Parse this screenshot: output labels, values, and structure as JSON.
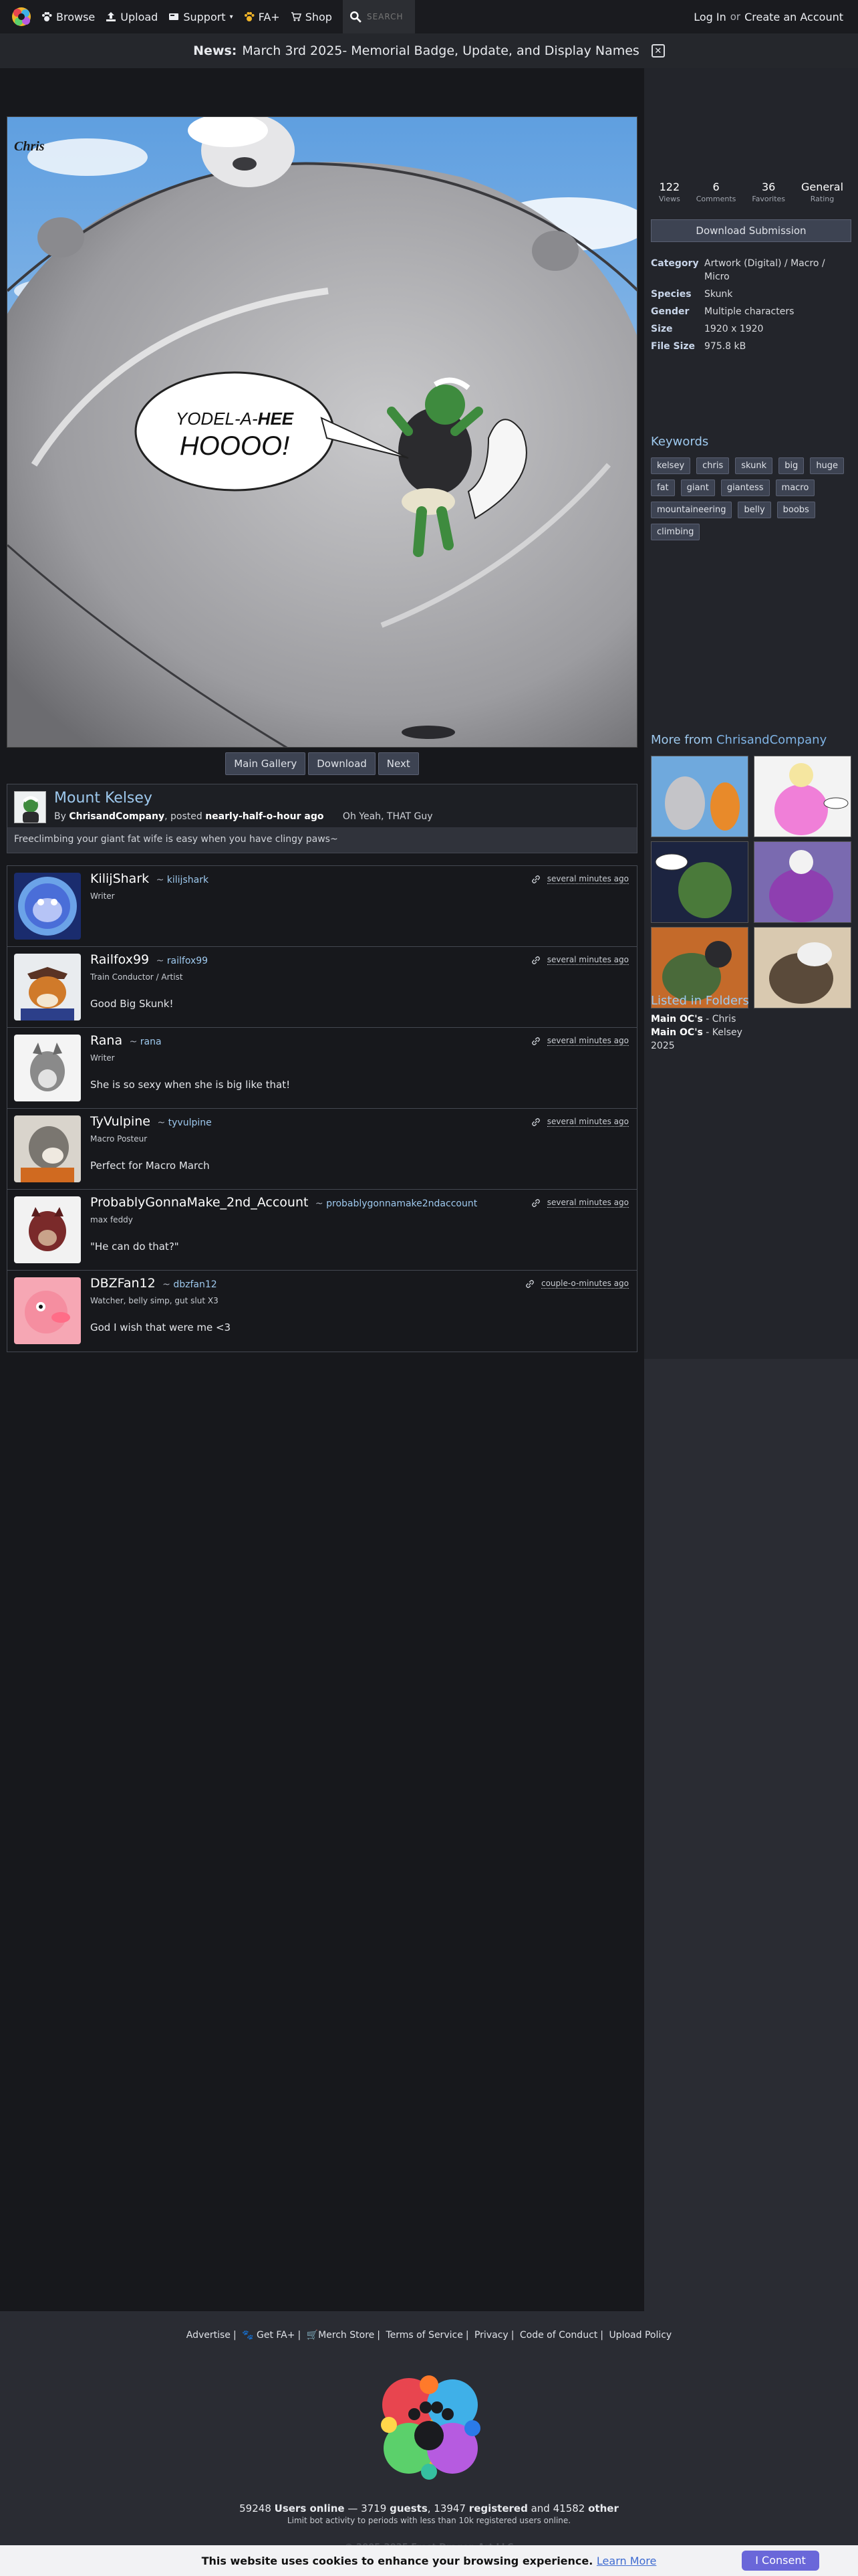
{
  "nav": {
    "browse": "Browse",
    "upload": "Upload",
    "support": "Support",
    "faplus": "FA+",
    "shop": "Shop",
    "search_placeholder": "SEARCH",
    "login": "Log In",
    "or": "or",
    "create": "Create an Account"
  },
  "news": {
    "label": "News:",
    "text": "March 3rd 2025- Memorial Badge, Update, and Display Names"
  },
  "artwork": {
    "bubble_line1a": "YODEL-A-",
    "bubble_line1b": "HEE",
    "bubble_line2": "HOOOO!",
    "signature": "Chris"
  },
  "submission_buttons": {
    "main_gallery": "Main Gallery",
    "download": "Download",
    "next": "Next"
  },
  "submission": {
    "title": "Mount Kelsey",
    "by": "By",
    "author": "ChrisandCompany",
    "posted": ", posted",
    "time": "nearly-half-o-hour ago",
    "mood": "Oh Yeah, THAT Guy",
    "description": "Freeclimbing your giant fat wife is easy when you have clingy paws~"
  },
  "comments": [
    {
      "name": "KilijShark",
      "handle": "kilijshark",
      "title": "Writer",
      "text": "",
      "time": "several minutes ago"
    },
    {
      "name": "Railfox99",
      "handle": "railfox99",
      "title": "Train Conductor / Artist",
      "text": "Good Big Skunk!",
      "time": "several minutes ago"
    },
    {
      "name": "Rana",
      "handle": "rana",
      "title": "Writer",
      "text": "She is so sexy when she is big like that!",
      "time": "several minutes ago"
    },
    {
      "name": "TyVulpine",
      "handle": "tyvulpine",
      "title": "Macro Posteur",
      "text": "Perfect for Macro March",
      "time": "several minutes ago"
    },
    {
      "name": "ProbablyGonnaMake_2nd_Account",
      "handle": "probablygonnamake2ndaccount",
      "title": "max feddy",
      "text": "\"He can do that?\"",
      "time": "several minutes ago"
    },
    {
      "name": "DBZFan12",
      "handle": "dbzfan12",
      "title": "Watcher, belly simp, gut slut X3",
      "text": "God I wish that were me <3",
      "time": "couple-o-minutes ago"
    }
  ],
  "stats": [
    {
      "value": "122",
      "label": "Views"
    },
    {
      "value": "6",
      "label": "Comments"
    },
    {
      "value": "36",
      "label": "Favorites"
    },
    {
      "value": "General",
      "label": "Rating"
    }
  ],
  "sidebar": {
    "download_button": "Download Submission",
    "category_k": "Category",
    "category_v": "Artwork (Digital) / Macro / Micro",
    "species_k": "Species",
    "species_v": "Skunk",
    "gender_k": "Gender",
    "gender_v": "Multiple characters",
    "size_k": "Size",
    "size_v": "1920 x 1920",
    "filesize_k": "File Size",
    "filesize_v": "975.8 kB",
    "keywords_title": "Keywords",
    "keywords": [
      "kelsey",
      "chris",
      "skunk",
      "big",
      "huge",
      "fat",
      "giant",
      "giantess",
      "macro",
      "mountaineering",
      "belly",
      "boobs",
      "climbing"
    ],
    "more_from": "More from",
    "more_author": "ChrisandCompany",
    "folders_title": "Listed in Folders",
    "folder1_b": "Main OC's",
    "folder1_r": " - Chris",
    "folder2_b": "Main OC's",
    "folder2_r": " - Kelsey",
    "folder3": "2025"
  },
  "footer": {
    "advertise": "Advertise",
    "getfa": "Get FA+",
    "merch": "Merch Store",
    "tos": "Terms of Service",
    "privacy": "Privacy",
    "coc": "Code of Conduct",
    "upload_policy": "Upload Policy",
    "users_online_num": "59248",
    "users_online": "Users online",
    "dash": "—",
    "guests_num": "3719",
    "guests": "guests",
    "registered_num": "13947",
    "registered": "registered",
    "and": "and",
    "other_num": "41582",
    "other": "other",
    "limit": "Limit bot activity to periods with less than 10k registered users online.",
    "copyright": "© 2005-2025 Frost Dragon Art LLC"
  },
  "cookie": {
    "message": "This website uses cookies to enhance your browsing experience.",
    "learn_more": "Learn More",
    "consent": "I Consent"
  }
}
